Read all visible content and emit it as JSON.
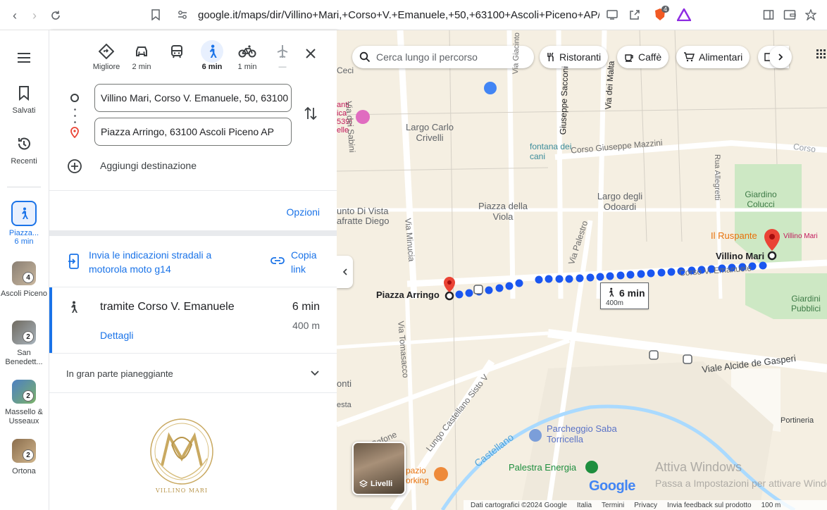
{
  "browser": {
    "url": "google.it/maps/dir/Villino+Mari,+Corso+V.+Emanuele,+50,+63100+Ascoli+Piceno+AP/Pi...",
    "extension_badge": "4"
  },
  "rail": {
    "saved_label": "Salvati",
    "recent_label": "Recenti",
    "active_trip": {
      "label": "Piazza...",
      "sub": "6 min"
    },
    "places": [
      {
        "label": "Ascoli Piceno",
        "count": "4"
      },
      {
        "label": "San Benedett...",
        "count": "2"
      },
      {
        "label": "Massello & Usseaux",
        "count": "2"
      },
      {
        "label": "Ortona",
        "count": "2"
      }
    ]
  },
  "modes": [
    {
      "name": "best",
      "label": "Migliore"
    },
    {
      "name": "car",
      "label": "2 min"
    },
    {
      "name": "transit",
      "label": ""
    },
    {
      "name": "walk",
      "label": "6 min"
    },
    {
      "name": "bike",
      "label": "1 min"
    },
    {
      "name": "flight",
      "label": "—"
    }
  ],
  "origin": "Villino Mari, Corso V. Emanuele, 50, 63100",
  "destination": "Piazza Arringo, 63100 Ascoli Piceno AP",
  "add_destination": "Aggiungi destinazione",
  "options_label": "Opzioni",
  "send_directions": "Invia le indicazioni stradali a motorola moto g14",
  "copy_link": "Copia link",
  "route": {
    "via": "tramite Corso V. Emanuele",
    "time": "6 min",
    "distance": "400 m",
    "details": "Dettagli"
  },
  "terrain": "In gran parte pianeggiante",
  "logo_text": "VILLINO MARI",
  "map": {
    "search_placeholder": "Cerca lungo il percorso",
    "chips": [
      "Ristoranti",
      "Caffè",
      "Alimentari"
    ],
    "labels": {
      "largo_carlo": "Largo Carlo Crivelli",
      "fontana": "fontana dei cani",
      "mazzini": "Corso Giuseppe Mazzini",
      "largo_odoardi": "Largo degli Odoardi",
      "piazza_viola": "Piazza della Viola",
      "giardino": "Giardino Colucci",
      "ruspante": "Il Ruspante",
      "villino_small": "Villino Mari",
      "villino": "Villino Mari",
      "arringo": "Piazza Arringo",
      "corso_ve": "Corso V. Emanuele",
      "giardini": "Giardini Pubblici",
      "via_sabini": "Via dei Sabini",
      "via_giacinto": "Via Giacinto Cantalamessa",
      "via_sacconi": "Giuseppe Sacconi",
      "via_malta": "Via dei Malta",
      "rua_alleg": "Rua Allegretti",
      "via_minucia": "Via Minucia",
      "via_palestro": "Via Palestro",
      "via_tomasacco": "Via Tomasacco",
      "viale_alcide": "Viale Alcide de Gasperi",
      "lungo": "Lungo Castellano Sisto V",
      "via_cafone": "Via Cafone",
      "castellano": "Castellano",
      "parcheggio": "Parcheggio Saba Torricella",
      "palestra": "Palestra Energia",
      "portineria": "Portineria",
      "vista": "unto Di Vista afratte Diego",
      "ceci": "Ceci",
      "onti": "onti",
      "esta": "esta",
      "spazio": "pazio orking",
      "hotel": "anti ica 539) elle",
      "corso_right": "Corso"
    },
    "walk_badge": {
      "time": "6 min",
      "dist": "400m"
    },
    "layers": "Livelli",
    "google": "Google",
    "watermark_title": "Attiva Windows",
    "watermark_sub": "Passa a Impostazioni per attivare Windows.",
    "footer": [
      "Dati cartografici ©2024 Google",
      "Italia",
      "Termini",
      "Privacy",
      "Invia feedback sul prodotto",
      "100 m"
    ]
  },
  "colors": {
    "accent": "#1a73e8",
    "route": "#1a56f0",
    "pin": "#ea4335"
  }
}
